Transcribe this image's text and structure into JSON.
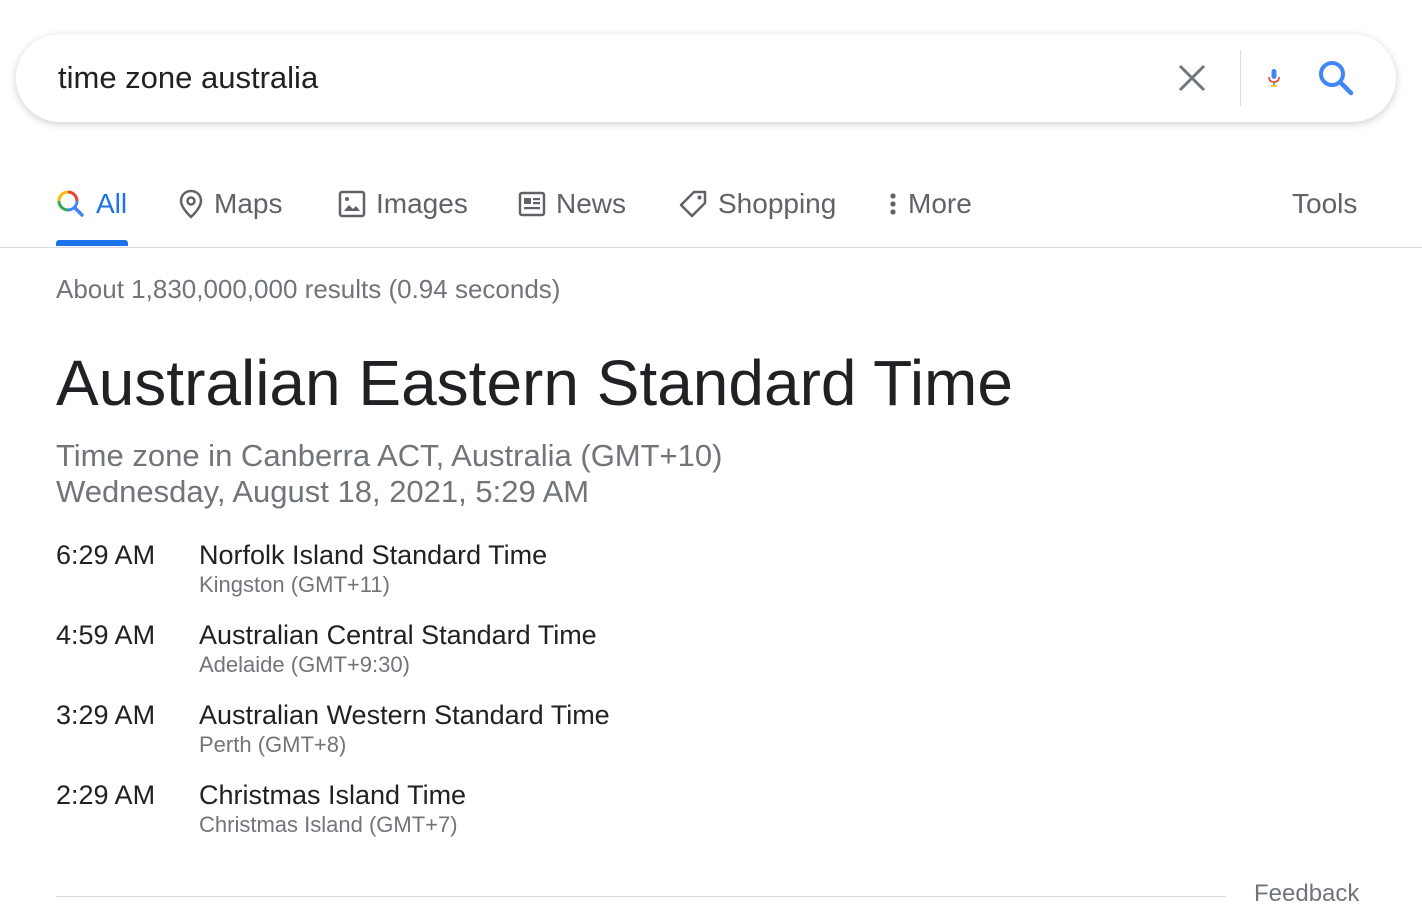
{
  "search": {
    "query": "time zone australia"
  },
  "tabs": [
    {
      "label": "All",
      "icon": "search-multicolor-icon"
    },
    {
      "label": "Maps",
      "icon": "map-pin-icon"
    },
    {
      "label": "Images",
      "icon": "image-icon"
    },
    {
      "label": "News",
      "icon": "news-icon"
    },
    {
      "label": "Shopping",
      "icon": "tag-icon"
    },
    {
      "label": "More",
      "icon": "vertical-dots-icon"
    }
  ],
  "tools_label": "Tools",
  "result_stats": "About 1,830,000,000 results (0.94 seconds)",
  "timezone": {
    "title": "Australian Eastern Standard Time",
    "subtitle": "Time zone in Canberra ACT, Australia (GMT+10)",
    "datetime": "Wednesday, August 18, 2021, 5:29 AM",
    "others": [
      {
        "time": "6:29 AM",
        "name": "Norfolk Island Standard Time",
        "place": "Kingston (GMT+11)"
      },
      {
        "time": "4:59 AM",
        "name": "Australian Central Standard Time",
        "place": "Adelaide (GMT+9:30)"
      },
      {
        "time": "3:29 AM",
        "name": "Australian Western Standard Time",
        "place": "Perth (GMT+8)"
      },
      {
        "time": "2:29 AM",
        "name": "Christmas Island Time",
        "place": "Christmas Island (GMT+7)"
      }
    ]
  },
  "feedback_label": "Feedback",
  "colors": {
    "accent": "#1a73e8",
    "text": "#202124",
    "secondary": "#70757a"
  }
}
